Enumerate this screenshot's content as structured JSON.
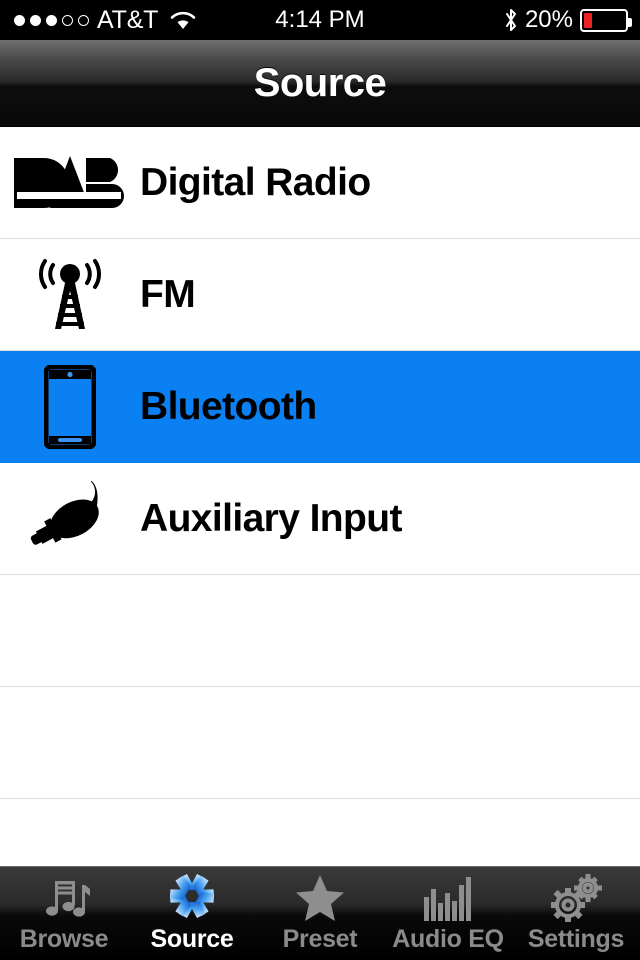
{
  "statusbar": {
    "signal_dots_total": 5,
    "signal_dots_filled": 3,
    "carrier": "AT&T",
    "wifi_icon": "wifi-icon",
    "time": "4:14 PM",
    "bluetooth_icon": "bluetooth-icon",
    "battery_percent_label": "20%",
    "battery_level": 20,
    "battery_color": "#ec2227"
  },
  "navbar": {
    "title": "Source"
  },
  "list": {
    "selected_color": "#0a80f2",
    "items": [
      {
        "label": "Digital Radio",
        "icon": "dab-logo-icon",
        "selected": false
      },
      {
        "label": "FM",
        "icon": "radio-tower-icon",
        "selected": false
      },
      {
        "label": "Bluetooth",
        "icon": "phone-icon",
        "selected": true
      },
      {
        "label": "Auxiliary Input",
        "icon": "audio-jack-icon",
        "selected": false
      }
    ],
    "empty_rows": 3
  },
  "tabbar": {
    "tabs": [
      {
        "label": "Browse",
        "icon": "music-notes-icon",
        "active": false
      },
      {
        "label": "Source",
        "icon": "pinwheel-icon",
        "active": true
      },
      {
        "label": "Preset",
        "icon": "star-icon",
        "active": false
      },
      {
        "label": "Audio EQ",
        "icon": "equalizer-icon",
        "active": false
      },
      {
        "label": "Settings",
        "icon": "gears-icon",
        "active": false
      }
    ]
  }
}
